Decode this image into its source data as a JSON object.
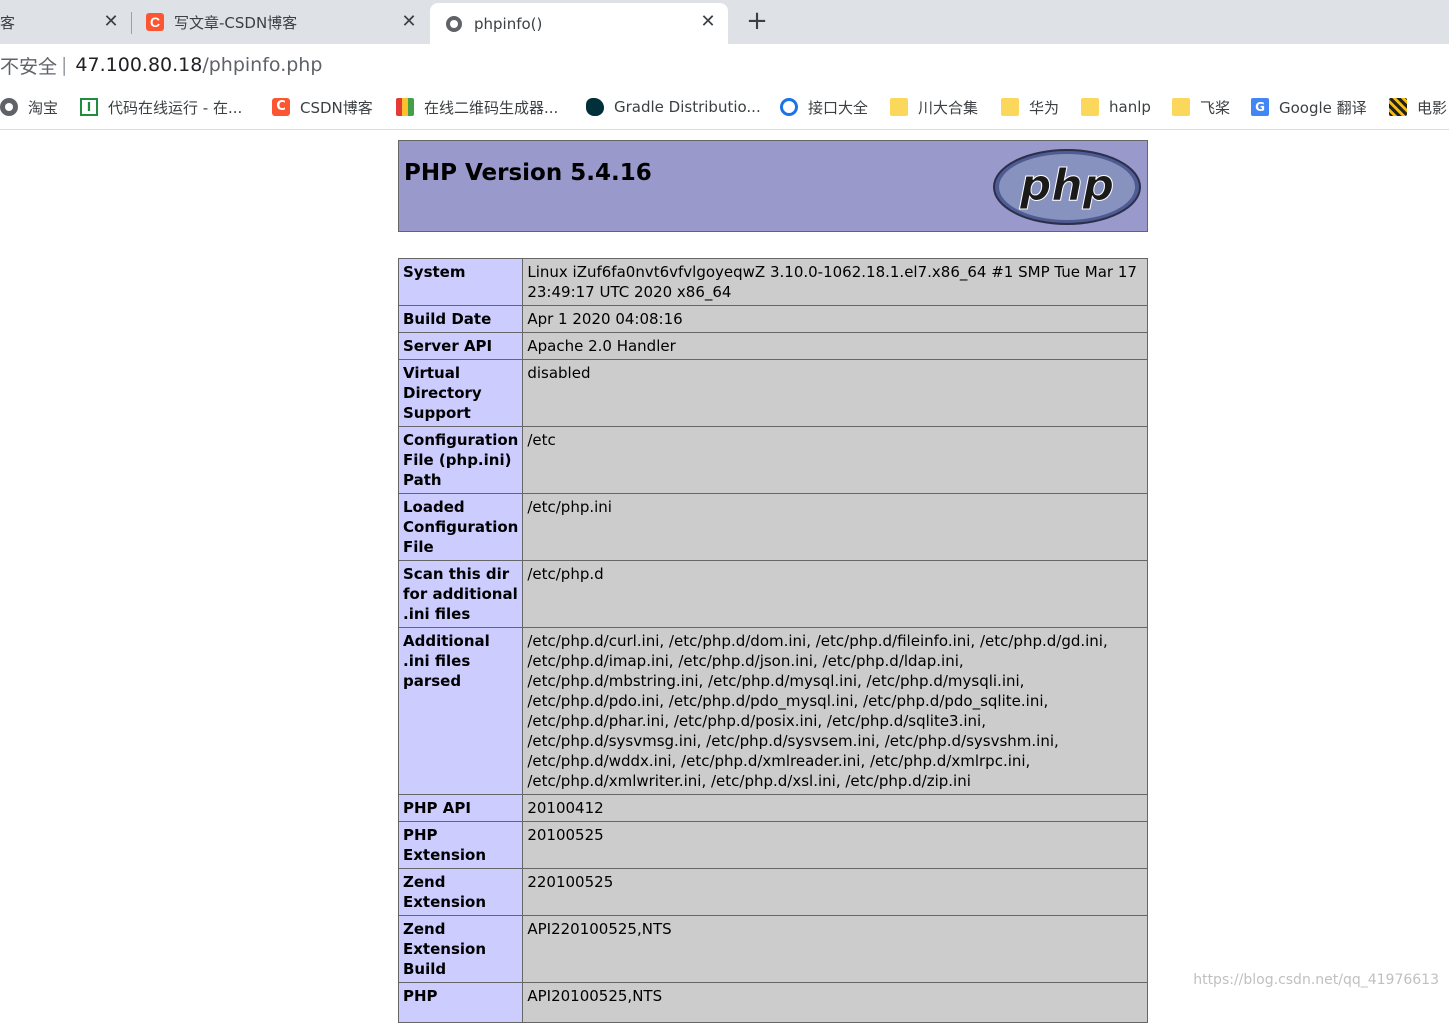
{
  "browser": {
    "tabs": [
      {
        "title": "客",
        "favicon": "csdn-icon",
        "active": false
      },
      {
        "title": "写文章-CSDN博客",
        "favicon": "csdn-icon",
        "active": false
      },
      {
        "title": "phpinfo()",
        "favicon": "globe-icon",
        "active": true
      }
    ],
    "close_symbol": "✕",
    "new_tab_symbol": "+",
    "address": {
      "security_label": "不安全",
      "host": "47.100.80.18",
      "path": "/phpinfo.php"
    },
    "bookmarks": [
      {
        "label": "淘宝",
        "icon": "globe-icon"
      },
      {
        "label": "代码在线运行 - 在...",
        "icon": "code-icon"
      },
      {
        "label": "CSDN博客",
        "icon": "csdn-icon"
      },
      {
        "label": "在线二维码生成器...",
        "icon": "qr-icon"
      },
      {
        "label": "Gradle Distributio...",
        "icon": "gradle-icon"
      },
      {
        "label": "接口大全",
        "icon": "api-icon"
      },
      {
        "label": "川大合集",
        "icon": "folder-icon"
      },
      {
        "label": "华为",
        "icon": "folder-icon"
      },
      {
        "label": "hanlp",
        "icon": "folder-icon"
      },
      {
        "label": "飞桨",
        "icon": "folder-icon"
      },
      {
        "label": "Google 翻译",
        "icon": "google-translate-icon"
      },
      {
        "label": "电影",
        "icon": "movie-icon"
      }
    ]
  },
  "phpinfo": {
    "title": "PHP Version 5.4.16",
    "logo_text": "php",
    "rows": [
      {
        "key": "System",
        "value": "Linux iZuf6fa0nvt6vfvlgoyeqwZ 3.10.0-1062.18.1.el7.x86_64 #1 SMP Tue Mar 17 23:49:17 UTC 2020 x86_64"
      },
      {
        "key": "Build Date",
        "value": "Apr 1 2020 04:08:16"
      },
      {
        "key": "Server API",
        "value": "Apache 2.0 Handler"
      },
      {
        "key": "Virtual Directory Support",
        "value": "disabled"
      },
      {
        "key": "Configuration File (php.ini) Path",
        "value": "/etc"
      },
      {
        "key": "Loaded Configuration File",
        "value": "/etc/php.ini"
      },
      {
        "key": "Scan this dir for additional .ini files",
        "value": "/etc/php.d"
      },
      {
        "key": "Additional .ini files parsed",
        "value": "/etc/php.d/curl.ini, /etc/php.d/dom.ini, /etc/php.d/fileinfo.ini, /etc/php.d/gd.ini, /etc/php.d/imap.ini, /etc/php.d/json.ini, /etc/php.d/ldap.ini, /etc/php.d/mbstring.ini, /etc/php.d/mysql.ini, /etc/php.d/mysqli.ini, /etc/php.d/pdo.ini, /etc/php.d/pdo_mysql.ini, /etc/php.d/pdo_sqlite.ini, /etc/php.d/phar.ini, /etc/php.d/posix.ini, /etc/php.d/sqlite3.ini, /etc/php.d/sysvmsg.ini, /etc/php.d/sysvsem.ini, /etc/php.d/sysvshm.ini, /etc/php.d/wddx.ini, /etc/php.d/xmlreader.ini, /etc/php.d/xmlrpc.ini, /etc/php.d/xmlwriter.ini, /etc/php.d/xsl.ini, /etc/php.d/zip.ini"
      },
      {
        "key": "PHP API",
        "value": "20100412"
      },
      {
        "key": "PHP Extension",
        "value": "20100525"
      },
      {
        "key": "Zend Extension",
        "value": "220100525"
      },
      {
        "key": "Zend Extension Build",
        "value": "API220100525,NTS"
      },
      {
        "key": "PHP",
        "value": "API20100525,NTS"
      }
    ]
  },
  "watermark": "https://blog.csdn.net/qq_41976613"
}
